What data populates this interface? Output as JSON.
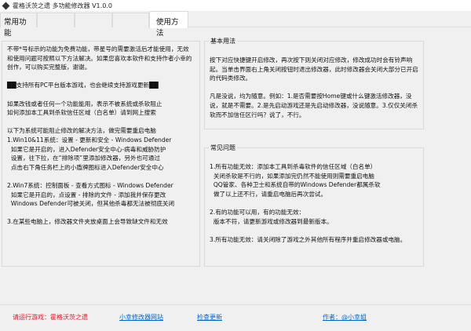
{
  "window": {
    "title": "霍格沃茨之遗 多功能修改器  V1.0.0"
  },
  "tabs": [
    {
      "label": "常用功能"
    },
    {
      "label": ""
    },
    {
      "label": ""
    },
    {
      "label": ""
    },
    {
      "label": "使用方法"
    }
  ],
  "left_text": "不带*号标示的功能为免费功能，带星号的需要激活后才能使用，无效和使用问题可按照以下方法解决。如果您喜欢本软件和支持作者小幸的创作，可以购买完整版，谢谢。\n\n██支持所有PC平台版本游戏，也会继续支持游戏更新██\n\n如果改钱或者任何一个功能能用，表示不被系统或杀软阻止\n如何添加本工具到杀软信任区域（白名单）请到网上搜索\n\n以下为系统可能阻止修改的解决方法，做完需要重启电脑\n1.Win10&11系统：设置 - 更新和安全 - Windows Defender\n  如果它是开启的，进入Defender安全中心-病毒和威胁防护\n  设置，往下拉，在“排除项”里添加修改器，另外也可通过\n  点击右下角任务栏上的小盾牌图标进入Defender安全中心\n\n2.Win7系统：控制面板 - 查看方式图标 - Windows Defender\n  如果它是开启的，点设置 - 排除的文件 - 添加我并保存更改\n  Windows Defender可被关闭，但其他杀毒都无法被彻底关闭\n\n3.在某些电脑上，修改器文件夹放桌面上会导致缺文件和无效",
  "basic_usage": {
    "title": "基本用法",
    "text": "按下对应快捷键开启修改，再次按下则关闭对应修改，修改成功时会有铃声响起。当单击界面右上角关闭按钮时退出修改器，此时修改器会关闭大部分已开启的代码类修改。\n\n凡是没说，均为随意。例如：1.是否需要按Home键或什么键激活修改器，没说，就是不需要。2.是先启动游戏还是先启动修改器，没说随意。3.仅仅关闭杀软而不加信任区行吗？说了，不行。"
  },
  "faq": {
    "title": "常见问题",
    "text": "1.所有功能无效：添加本工具到杀毒软件的信任区域（白名单）\n  关闭杀软是不行的，如果添加完仍然不能使用则需要重启电脑\n  QQ管家、各种卫士和系统自带的Windows Defender都属杀软\n  做了以上还不行，请重启电脑后再次尝试。\n\n2.有的功能可以用，有的功能无效：\n  版本不符，请更新游戏或修改器到最新版本。\n\n3.所有功能无效：请关闭除了游戏之外其他所有程序并重启修改器或电脑。"
  },
  "footer": {
    "run_game": "请运行游戏：霍格沃茨之遗",
    "website": "小幸修改器网站",
    "check_update": "检查更新",
    "author": "作者：@小幸姐"
  },
  "colors": {
    "red": "#e81123",
    "link": "#0066cc"
  }
}
